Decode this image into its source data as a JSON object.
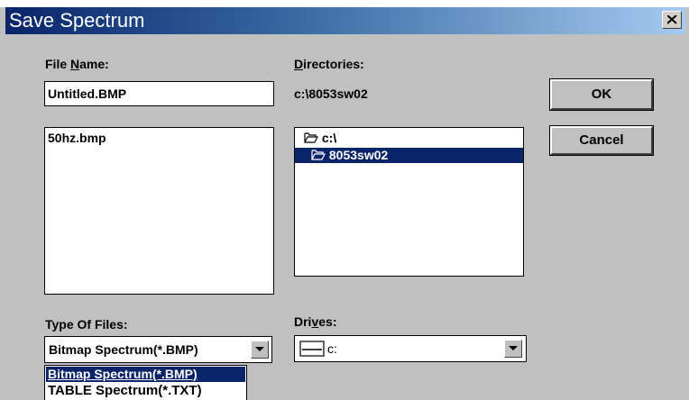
{
  "window": {
    "title": "Save Spectrum"
  },
  "file_name": {
    "label_pre": "File ",
    "label_accel": "N",
    "label_post": "ame:",
    "value": "Untitled.BMP",
    "files": [
      "50hz.bmp"
    ]
  },
  "directories": {
    "label_accel": "D",
    "label_post": "irectories:",
    "current_path": "c:\\8053sw02",
    "items": [
      {
        "label": "c:\\",
        "icon": "open-folder-icon",
        "selected": false
      },
      {
        "label": "8053sw02",
        "icon": "open-folder-icon",
        "selected": true
      }
    ]
  },
  "buttons": {
    "ok": "OK",
    "cancel": "Cancel"
  },
  "file_type": {
    "label": "Type Of Files:",
    "selected": "Bitmap Spectrum(*.BMP)",
    "options": [
      "Bitmap Spectrum(*.BMP)",
      "TABLE Spectrum(*.TXT)"
    ]
  },
  "drives": {
    "label_pre": "Dri",
    "label_accel": "v",
    "label_post": "es:",
    "selected": "c:",
    "icon": "drive-icon"
  },
  "colors": {
    "selection": "#0a246a",
    "dialog_bg": "#c0c0c0",
    "title_start": "#0a246a",
    "title_end": "#a6caf0"
  }
}
